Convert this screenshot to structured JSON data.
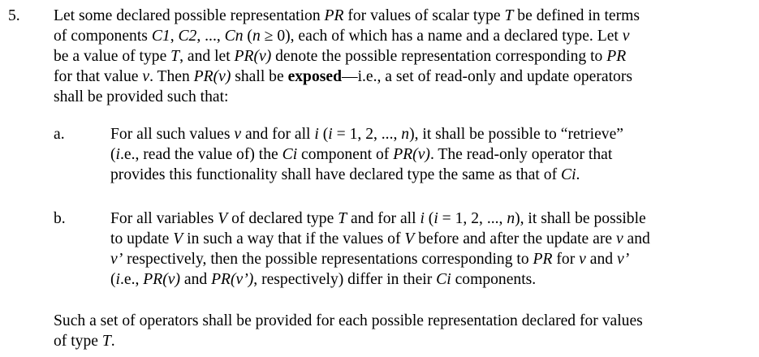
{
  "document": {
    "item_number": "5.",
    "intro_lines": [
      "Let some declared possible representation PR for values of scalar type T be defined in terms",
      "of components C1, C2, ..., Cn (n ≥ 0), each of which has a name and a declared type.  Let v",
      "be a value of type T, and let PR(v) denote the possible representation corresponding to PR",
      "for that value v.  Then PR(v) shall be exposed—i.e., a set of read-only and update operators",
      "shall be provided such that:"
    ],
    "sub_items": [
      {
        "label": "a.",
        "lines": [
          "For all such values v and for all i (i = 1, 2, ..., n), it shall be possible to “retrieve”",
          "(i.e., read the value of) the Ci component of PR(v).  The read-only operator that",
          "provides this functionality shall have declared type the same as that of Ci."
        ]
      },
      {
        "label": "b.",
        "lines": [
          "For all variables V of declared type T and for all i (i = 1, 2, ..., n), it shall be possible",
          "to update V in such a way that if the values of V before and after the update are v and",
          "v’ respectively, then the possible representations corresponding to PR for v and v’",
          "(i.e., PR(v) and PR(v’), respectively) differ in their Ci components."
        ]
      }
    ],
    "closing_lines": [
      "Such a set of operators shall be provided for each possible representation declared for values",
      "of type T."
    ]
  }
}
